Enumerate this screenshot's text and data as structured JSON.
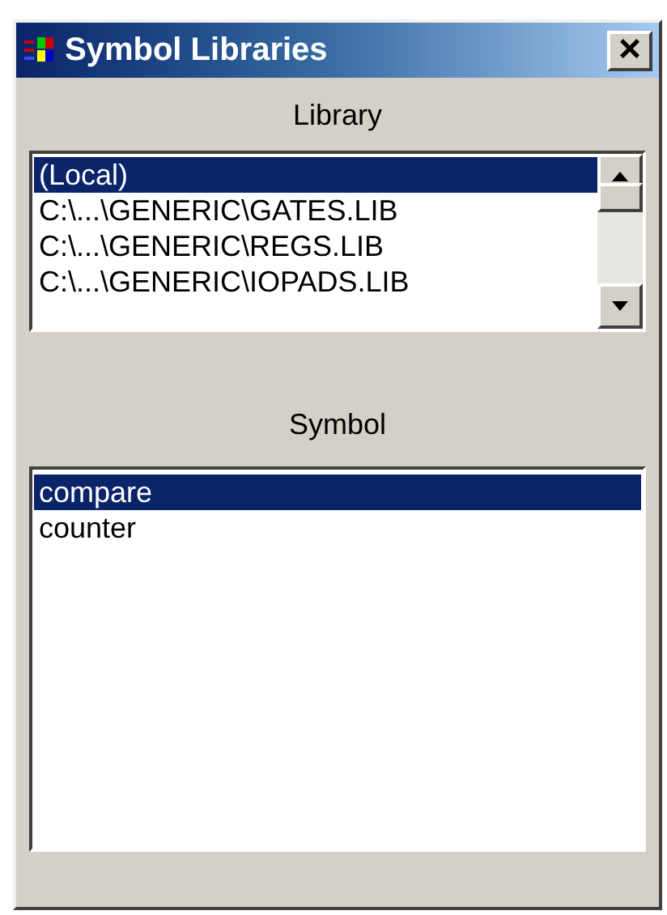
{
  "window": {
    "title": "Symbol Libraries",
    "close": "×"
  },
  "library": {
    "label": "Library",
    "items": [
      {
        "text": "(Local)",
        "selected": true
      },
      {
        "text": "C:\\...\\GENERIC\\GATES.LIB",
        "selected": false
      },
      {
        "text": "C:\\...\\GENERIC\\REGS.LIB",
        "selected": false
      },
      {
        "text": "C:\\...\\GENERIC\\IOPADS.LIB",
        "selected": false
      }
    ]
  },
  "symbol": {
    "label": "Symbol",
    "items": [
      {
        "text": "compare",
        "selected": true
      },
      {
        "text": "counter",
        "selected": false
      }
    ]
  }
}
